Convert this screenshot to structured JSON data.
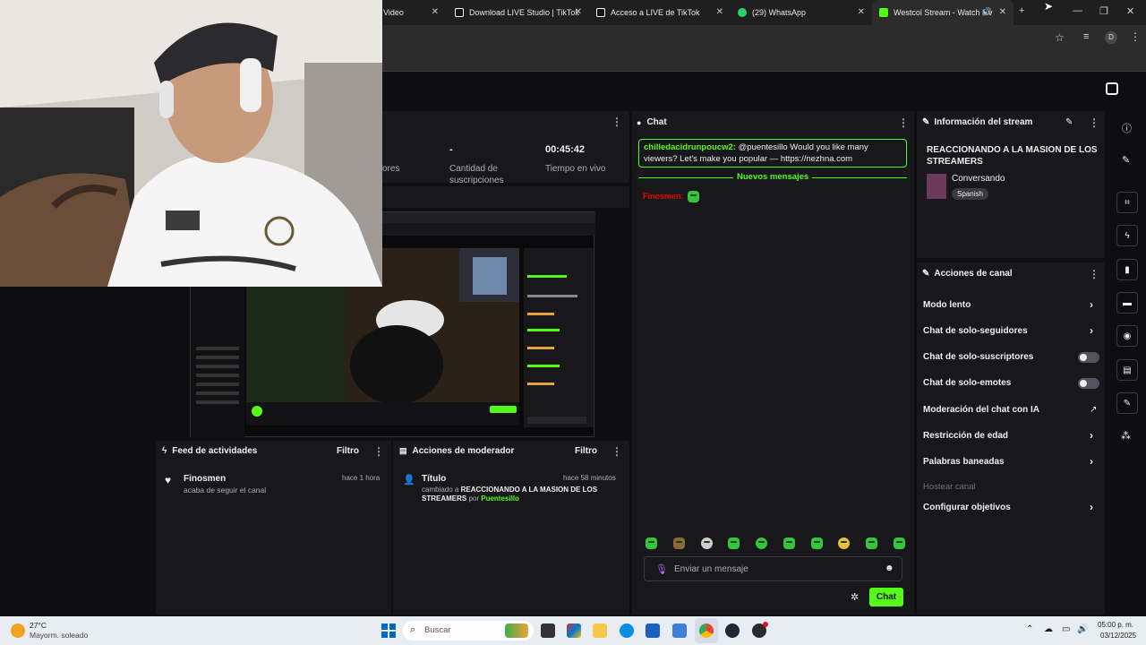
{
  "browser": {
    "tabs": [
      {
        "title": "Video"
      },
      {
        "title": "Download LIVE Studio | TikTok"
      },
      {
        "title": "Acceso a LIVE de TikTok"
      },
      {
        "title": "(29) WhatsApp"
      },
      {
        "title": "Westcol Stream - Watch Liv"
      }
    ],
    "new_tab": "+",
    "minimize": "—",
    "restore": "❐",
    "close": "✕",
    "profile_initial": "D"
  },
  "stats": {
    "partial_label": "ores",
    "subs_value": "-",
    "subs_label_line1": "Cantidad de",
    "subs_label_line2": "suscripciones",
    "live_time_value": "00:45:42",
    "live_time_label": "Tiempo en vivo"
  },
  "chat": {
    "title": "Chat",
    "pinned_user": "chilledacidrunpoucw2:",
    "pinned_text": " @puentesillo Would you like many viewers? Let's make you popular — https://nezhna.com",
    "new_messages": "Nuevos mensajes",
    "messages": [
      {
        "user": "Finosmen:",
        "user_color": "#eb0400"
      }
    ],
    "input_placeholder": "Enviar un mensaje",
    "send_button": "Chat",
    "accent": "#53fc18"
  },
  "stream_info": {
    "title": "Información del stream",
    "stream_title": "REACCIONANDO A LA MASION DE LOS STREAMERS",
    "category": "Conversando",
    "language": "Spanish"
  },
  "channel_actions": {
    "title": "Acciones de canal",
    "items": [
      {
        "label": "Modo lento",
        "control": "chevron"
      },
      {
        "label": "Chat de solo-seguidores",
        "control": "chevron"
      },
      {
        "label": "Chat de solo-suscriptores",
        "control": "toggle"
      },
      {
        "label": "Chat de solo-emotes",
        "control": "toggle"
      },
      {
        "label": "Moderación del chat con IA",
        "control": "external"
      },
      {
        "label": "Restricción de edad",
        "control": "chevron"
      },
      {
        "label": "Palabras baneadas",
        "control": "chevron"
      },
      {
        "label": "Hostear canal",
        "control": "disabled"
      },
      {
        "label": "Configurar objetivos",
        "control": "chevron"
      }
    ]
  },
  "activity_feed": {
    "title": "Feed de actividades",
    "filter": "Filtro",
    "item_user": "Finosmen",
    "item_time": "hace 1 hora",
    "item_text": "acaba de seguir el canal"
  },
  "mod_actions": {
    "title": "Acciones de moderador",
    "filter": "Filtro",
    "item_title": "Título",
    "item_time": "hace 58 minutos",
    "item_prefix": "cambiado a ",
    "item_value": "REACCIONANDO A LA MASION DE LOS STREAMERS",
    "item_by": " por ",
    "item_user": "Puentesillo"
  },
  "taskbar": {
    "weather_temp": "27°C",
    "weather_desc": "Mayorm. soleado",
    "search_placeholder": "Buscar",
    "time": "05:00 p. m.",
    "date": "03/12/2025"
  }
}
